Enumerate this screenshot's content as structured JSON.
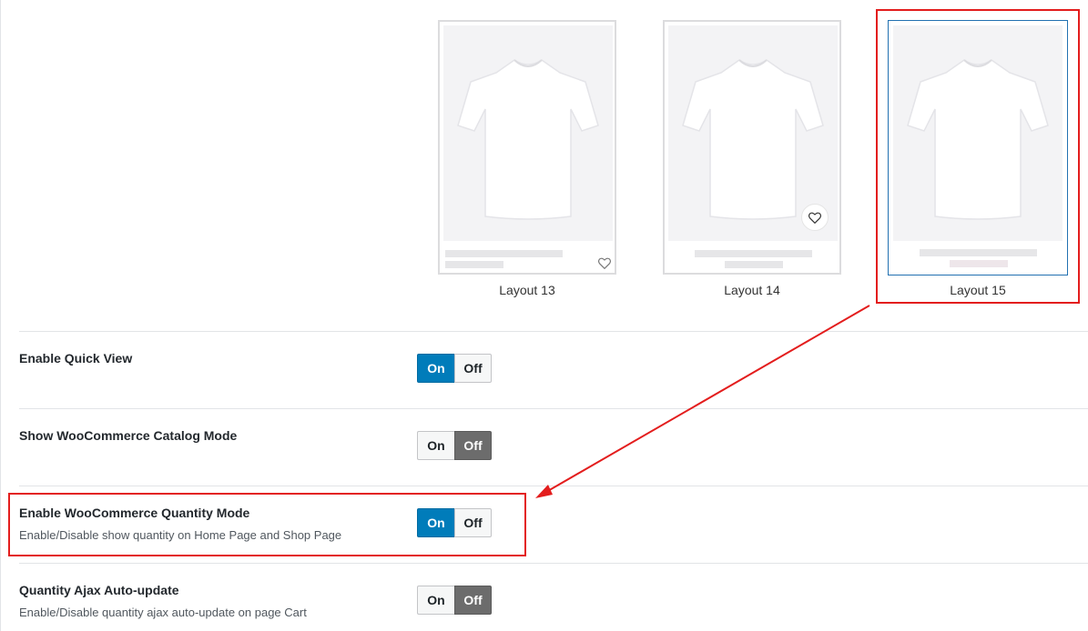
{
  "layouts": [
    {
      "label": "Layout 13",
      "heart_style": "small-bottom-right"
    },
    {
      "label": "Layout 14",
      "heart_style": "circle-on-image"
    },
    {
      "label": "Layout 15",
      "heart_style": "none",
      "selected": true
    }
  ],
  "settings": [
    {
      "title": "Enable Quick View",
      "description": "",
      "on_label": "On",
      "off_label": "Off",
      "value": "on"
    },
    {
      "title": "Show WooCommerce Catalog Mode",
      "description": "",
      "on_label": "On",
      "off_label": "Off",
      "value": "off"
    },
    {
      "title": "Enable WooCommerce Quantity Mode",
      "description": "Enable/Disable show quantity on Home Page and Shop Page",
      "on_label": "On",
      "off_label": "Off",
      "value": "on"
    },
    {
      "title": "Quantity Ajax Auto-update",
      "description": "Enable/Disable quantity ajax auto-update on page Cart",
      "on_label": "On",
      "off_label": "Off",
      "value": "off"
    }
  ],
  "colors": {
    "accent": "#007cba",
    "annotation": "#e31d1d",
    "off_active": "#6c6c6c"
  }
}
